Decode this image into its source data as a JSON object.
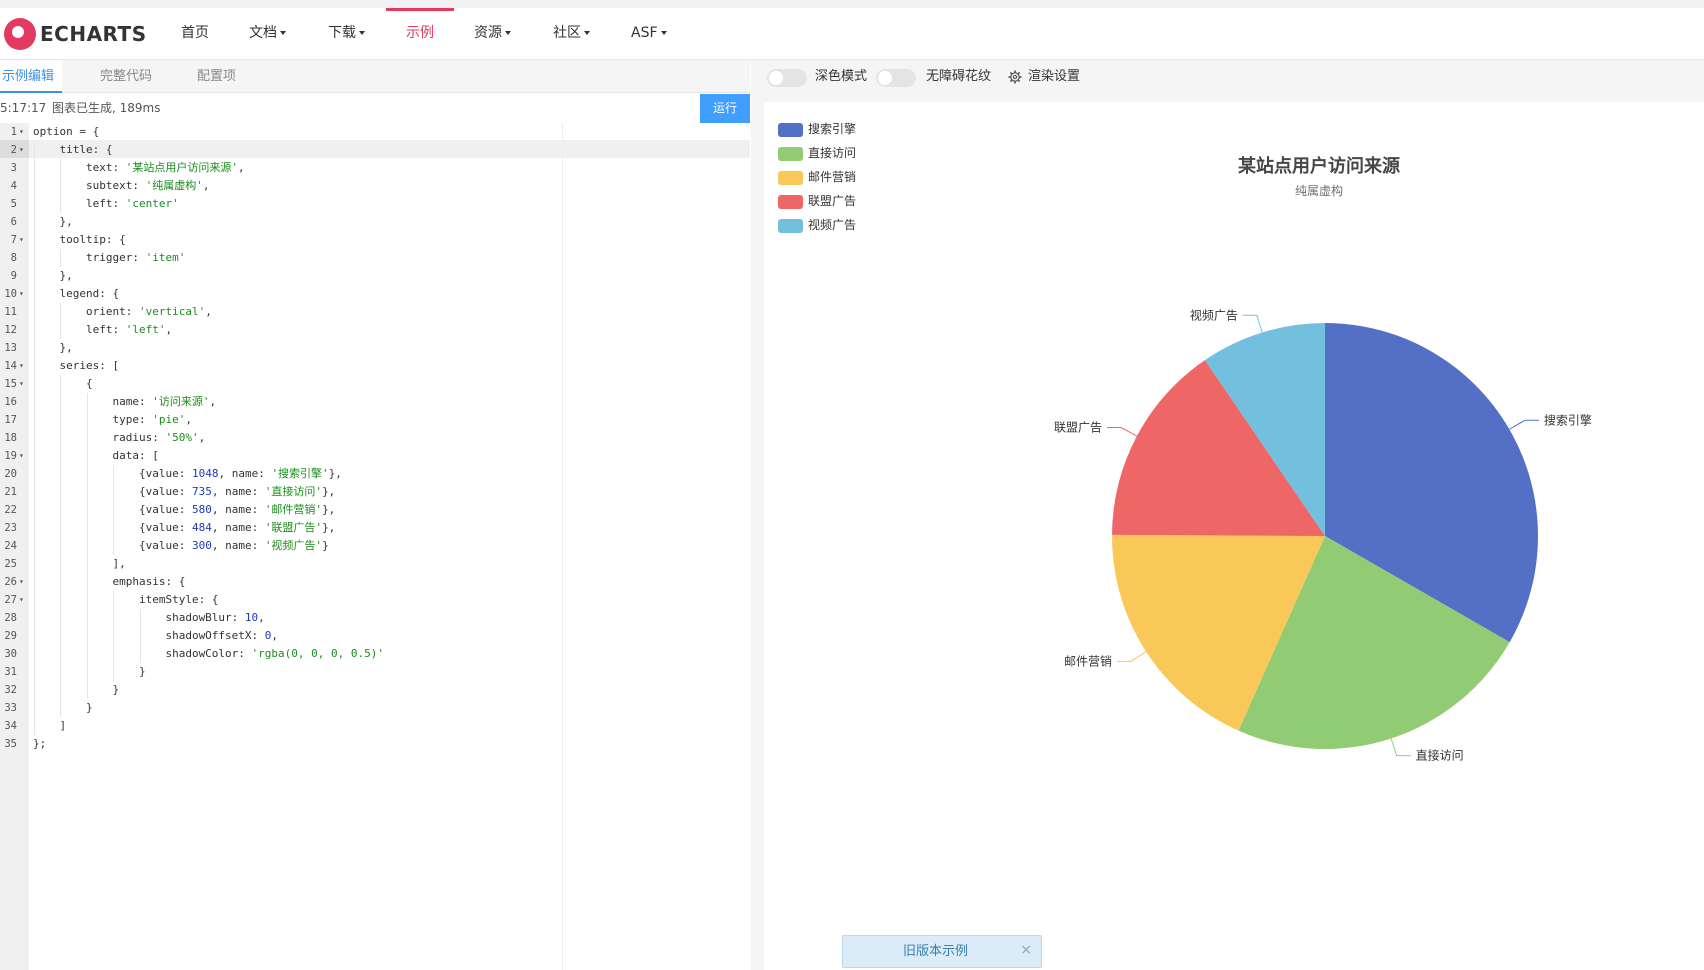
{
  "nav": {
    "logo_text": "ECHARTS",
    "items": [
      {
        "label": "首页",
        "dropdown": false
      },
      {
        "label": "文档",
        "dropdown": true
      },
      {
        "label": "下载",
        "dropdown": true
      },
      {
        "label": "示例",
        "dropdown": false,
        "active": true
      },
      {
        "label": "资源",
        "dropdown": true
      },
      {
        "label": "社区",
        "dropdown": true
      },
      {
        "label": "ASF",
        "dropdown": true
      }
    ],
    "accent_color": "#e43961"
  },
  "editor_panel": {
    "tabs": [
      {
        "label": "示例编辑",
        "active": true
      },
      {
        "label": "完整代码",
        "active": false
      },
      {
        "label": "配置项",
        "active": false
      }
    ],
    "status_time": "5:17:17",
    "status_message": "图表已生成, 189ms",
    "run_label": "运行",
    "run_color": "#409eff",
    "code_lines": [
      "option = {",
      "    title: {",
      "        text: '某站点用户访问来源',",
      "        subtext: '纯属虚构',",
      "        left: 'center'",
      "    },",
      "    tooltip: {",
      "        trigger: 'item'",
      "    },",
      "    legend: {",
      "        orient: 'vertical',",
      "        left: 'left',",
      "    },",
      "    series: [",
      "        {",
      "            name: '访问来源',",
      "            type: 'pie',",
      "            radius: '50%',",
      "            data: [",
      "                {value: 1048, name: '搜索引擎'},",
      "                {value: 735, name: '直接访问'},",
      "                {value: 580, name: '邮件营销'},",
      "                {value: 484, name: '联盟广告'},",
      "                {value: 300, name: '视频广告'}",
      "            ],",
      "            emphasis: {",
      "                itemStyle: {",
      "                    shadowBlur: 10,",
      "                    shadowOffsetX: 0,",
      "                    shadowColor: 'rgba(0, 0, 0, 0.5)'",
      "                }",
      "            }",
      "        }",
      "    ]",
      "};"
    ],
    "fold_lines": [
      1,
      2,
      7,
      10,
      14,
      15,
      19,
      26,
      27
    ]
  },
  "preview_panel": {
    "dark_mode_label": "深色模式",
    "accessible_label": "无障碍花纹",
    "render_settings_label": "渲染设置",
    "old_version_label": "旧版本示例",
    "close_symbol": "×"
  },
  "chart_data": {
    "type": "pie",
    "title": "某站点用户访问来源",
    "subtitle": "纯属虚构",
    "series_name": "访问来源",
    "legend_position": "top-left, vertical",
    "slices": [
      {
        "name": "搜索引擎",
        "value": 1048,
        "color": "#5470c6"
      },
      {
        "name": "直接访问",
        "value": 735,
        "color": "#91cc75"
      },
      {
        "name": "邮件营销",
        "value": 580,
        "color": "#fac858"
      },
      {
        "name": "联盟广告",
        "value": 484,
        "color": "#ee6666"
      },
      {
        "name": "视频广告",
        "value": 300,
        "color": "#73c0de"
      }
    ]
  }
}
